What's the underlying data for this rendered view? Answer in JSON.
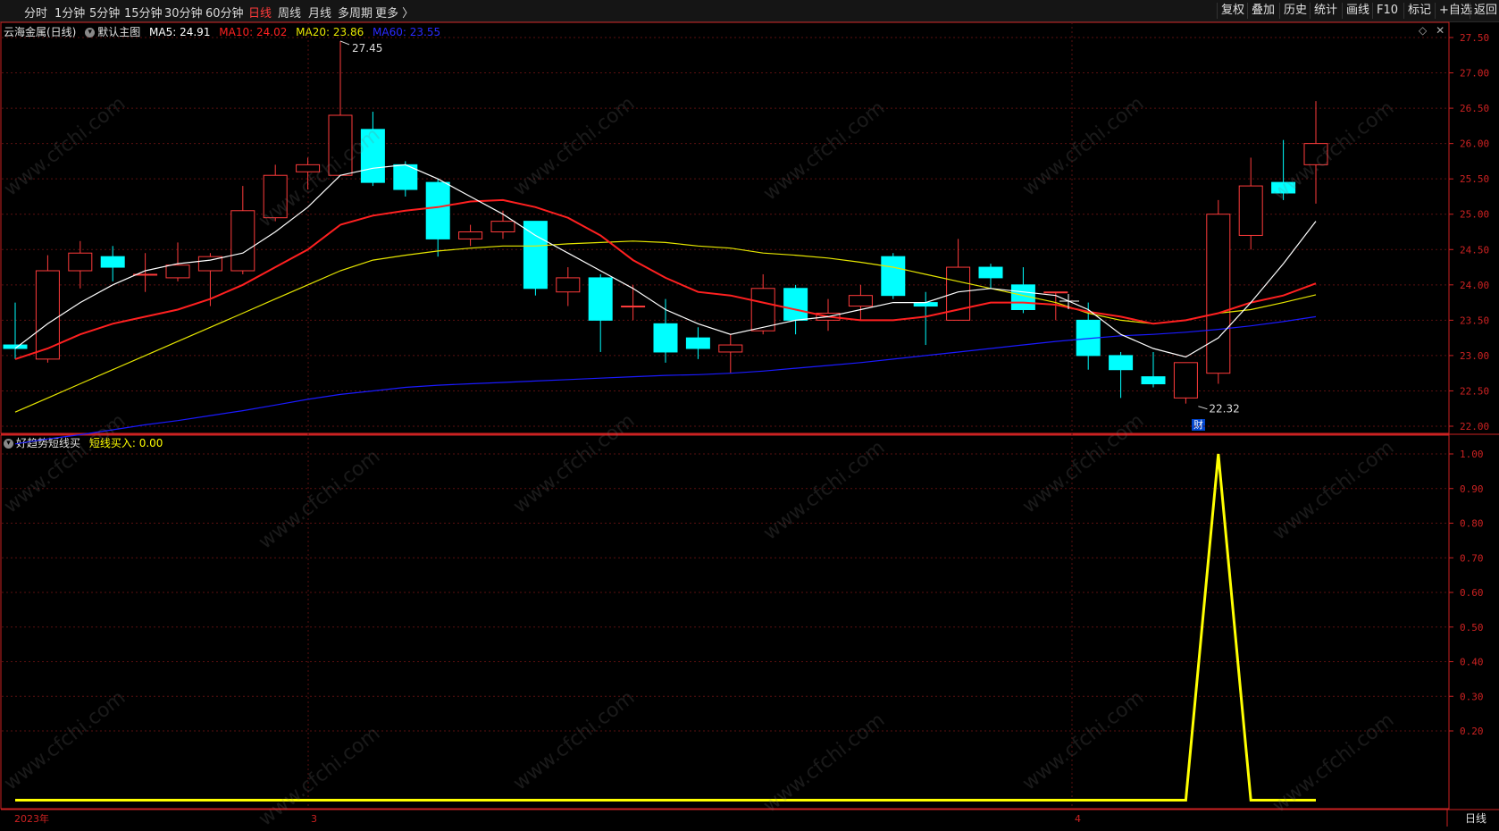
{
  "toolbar": {
    "left": [
      "分时",
      "1分钟",
      "5分钟",
      "15分钟",
      "30分钟",
      "60分钟",
      "日线",
      "周线",
      "月线",
      "多周期",
      "更多 〉"
    ],
    "active": "日线",
    "right": [
      "复权",
      "叠加",
      "历史",
      "统计",
      "画线",
      "F10",
      "标记",
      "+自选",
      "返回"
    ]
  },
  "main_legend": {
    "name": "云海金属(日线)",
    "template": "默认主图",
    "ma5": "MA5: 24.91",
    "ma10": "MA10: 24.02",
    "ma20": "MA20: 23.86",
    "ma60": "MA60: 23.55"
  },
  "indicator_legend": {
    "name": "好趋势短线买",
    "value": "短线买入: 0.00"
  },
  "annotations": {
    "high": "27.45",
    "low": "22.32",
    "cai": "财"
  },
  "bottom": {
    "year": "2023年",
    "m3": "3",
    "m4": "4",
    "period": "日线"
  },
  "watermark": "www.cfchi.com",
  "colors": {
    "up": "#ff3b3b",
    "down": "#00ffff",
    "ma5": "#ffffff",
    "ma10": "#ff2020",
    "ma20": "#e6e600",
    "ma60": "#1a1aff",
    "signal": "#ffff00",
    "axis": "#cc2222"
  },
  "chart_data": [
    {
      "type": "candlestick",
      "ylim": [
        21.6,
        27.6
      ],
      "y_ticks": [
        "27.50",
        "27.00",
        "26.50",
        "26.00",
        "25.50",
        "25.00",
        "24.50",
        "24.00",
        "23.50",
        "23.00",
        "22.50",
        "22.00"
      ],
      "candles": [
        [
          23.15,
          23.1,
          23.75,
          22.95
        ],
        [
          22.95,
          24.2,
          24.42,
          22.9
        ],
        [
          24.2,
          24.45,
          24.62,
          23.95
        ],
        [
          24.4,
          24.25,
          24.55,
          24.05
        ],
        [
          24.15,
          24.15,
          24.45,
          23.9
        ],
        [
          24.1,
          24.28,
          24.6,
          24.05
        ],
        [
          24.2,
          24.4,
          24.45,
          23.7
        ],
        [
          24.2,
          25.05,
          25.4,
          24.15
        ],
        [
          24.95,
          25.55,
          25.7,
          24.9
        ],
        [
          25.6,
          25.7,
          25.8,
          25.35
        ],
        [
          25.55,
          26.4,
          27.45,
          25.55
        ],
        [
          26.2,
          25.45,
          26.45,
          25.4
        ],
        [
          25.7,
          25.35,
          25.75,
          25.25
        ],
        [
          25.45,
          24.65,
          25.5,
          24.4
        ],
        [
          24.65,
          24.75,
          24.85,
          24.55
        ],
        [
          24.75,
          24.9,
          25.05,
          24.65
        ],
        [
          24.9,
          23.95,
          24.9,
          23.85
        ],
        [
          23.9,
          24.1,
          24.25,
          23.7
        ],
        [
          24.1,
          23.5,
          24.15,
          23.05
        ],
        [
          23.7,
          23.7,
          24.0,
          23.5
        ],
        [
          23.45,
          23.05,
          23.8,
          22.9
        ],
        [
          23.25,
          23.1,
          23.4,
          22.95
        ],
        [
          23.05,
          23.15,
          23.3,
          22.75
        ],
        [
          23.35,
          23.95,
          24.15,
          23.3
        ],
        [
          23.95,
          23.5,
          24.0,
          23.3
        ],
        [
          23.5,
          23.6,
          23.8,
          23.35
        ],
        [
          23.7,
          23.85,
          24.0,
          23.5
        ],
        [
          24.4,
          23.85,
          24.45,
          23.8
        ],
        [
          23.75,
          23.7,
          23.9,
          23.15
        ],
        [
          23.5,
          24.25,
          24.65,
          23.5
        ],
        [
          24.25,
          24.1,
          24.3,
          23.95
        ],
        [
          24.0,
          23.65,
          24.25,
          23.6
        ],
        [
          23.9,
          23.9,
          23.9,
          23.5
        ],
        [
          23.5,
          23.0,
          23.75,
          22.8
        ],
        [
          23.0,
          22.8,
          23.05,
          22.4
        ],
        [
          22.7,
          22.6,
          23.05,
          22.55
        ],
        [
          22.4,
          22.9,
          22.9,
          22.32
        ],
        [
          22.75,
          25.0,
          25.2,
          22.6
        ],
        [
          24.7,
          25.4,
          25.8,
          24.5
        ],
        [
          25.45,
          25.3,
          26.05,
          25.2
        ],
        [
          25.7,
          26.0,
          26.6,
          25.15
        ]
      ],
      "ma5": [
        23.1,
        23.45,
        23.75,
        24.0,
        24.2,
        24.3,
        24.35,
        24.45,
        24.75,
        25.1,
        25.55,
        25.65,
        25.7,
        25.5,
        25.25,
        25.0,
        24.7,
        24.45,
        24.2,
        23.95,
        23.65,
        23.45,
        23.3,
        23.4,
        23.5,
        23.55,
        23.65,
        23.75,
        23.75,
        23.9,
        23.95,
        23.9,
        23.85,
        23.65,
        23.3,
        23.1,
        22.98,
        23.25,
        23.75,
        24.3,
        24.9
      ],
      "ma10": [
        22.95,
        23.1,
        23.3,
        23.45,
        23.55,
        23.65,
        23.8,
        24.0,
        24.25,
        24.5,
        24.85,
        24.98,
        25.05,
        25.1,
        25.18,
        25.2,
        25.1,
        24.95,
        24.7,
        24.35,
        24.1,
        23.9,
        23.85,
        23.75,
        23.65,
        23.55,
        23.5,
        23.5,
        23.55,
        23.65,
        23.75,
        23.75,
        23.72,
        23.62,
        23.55,
        23.45,
        23.5,
        23.6,
        23.75,
        23.85,
        24.02
      ],
      "ma20": [
        22.2,
        22.4,
        22.6,
        22.8,
        23.0,
        23.2,
        23.4,
        23.6,
        23.8,
        24.0,
        24.2,
        24.35,
        24.42,
        24.48,
        24.52,
        24.55,
        24.55,
        24.58,
        24.6,
        24.62,
        24.6,
        24.55,
        24.52,
        24.45,
        24.42,
        24.38,
        24.32,
        24.25,
        24.15,
        24.05,
        23.95,
        23.85,
        23.75,
        23.6,
        23.5,
        23.45,
        23.5,
        23.6,
        23.65,
        23.75,
        23.86
      ],
      "ma60": [
        21.75,
        21.82,
        21.88,
        21.95,
        22.02,
        22.08,
        22.15,
        22.22,
        22.3,
        22.38,
        22.45,
        22.5,
        22.55,
        22.58,
        22.6,
        22.62,
        22.64,
        22.66,
        22.68,
        22.7,
        22.72,
        22.73,
        22.75,
        22.78,
        22.82,
        22.86,
        22.9,
        22.95,
        23.0,
        23.05,
        23.1,
        23.15,
        23.2,
        23.24,
        23.28,
        23.3,
        23.33,
        23.37,
        23.42,
        23.48,
        23.55
      ]
    },
    {
      "type": "line",
      "series_name": "短线买入",
      "ylim": [
        0,
        1.05
      ],
      "y_ticks": [
        "1.00",
        "0.90",
        "0.80",
        "0.70",
        "0.60",
        "0.50",
        "0.40",
        "0.30",
        "0.20"
      ],
      "values": [
        0,
        0,
        0,
        0,
        0,
        0,
        0,
        0,
        0,
        0,
        0,
        0,
        0,
        0,
        0,
        0,
        0,
        0,
        0,
        0,
        0,
        0,
        0,
        0,
        0,
        0,
        0,
        0,
        0,
        0,
        0,
        0,
        0,
        0,
        0,
        0,
        0,
        1,
        0,
        0,
        0
      ]
    }
  ]
}
